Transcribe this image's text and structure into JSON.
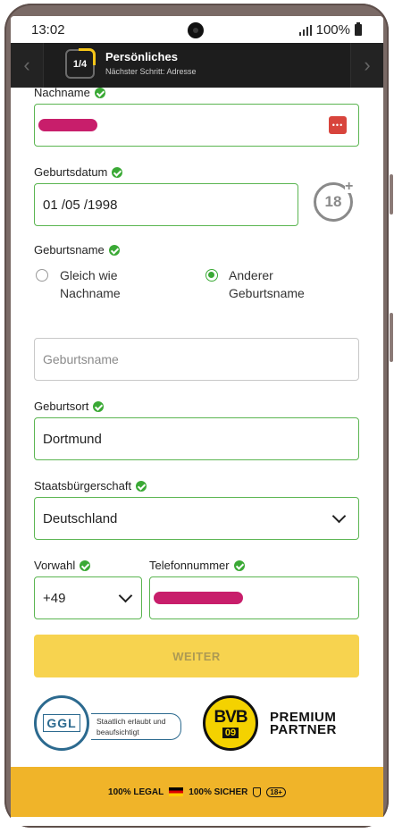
{
  "status_bar": {
    "time": "13:02",
    "battery": "100%"
  },
  "header": {
    "step": "1/4",
    "title": "Persönliches",
    "subtitle": "Nächster Schritt: Adresse",
    "prev_icon": "chevron-left-icon",
    "next_icon": "chevron-right-icon"
  },
  "form": {
    "nachname": {
      "label": "Nachname",
      "value": ""
    },
    "geburtsdatum": {
      "label": "Geburtsdatum",
      "value": "01 /05 /1998",
      "age_badge": "18"
    },
    "geburtsname": {
      "label": "Geburtsname",
      "option_same": "Gleich wie Nachname",
      "option_other": "Anderer Geburtsname",
      "selected": "Anderer Geburtsname",
      "placeholder": "Geburtsname"
    },
    "geburtsort": {
      "label": "Geburtsort",
      "value": "Dortmund"
    },
    "staatsbuergerschaft": {
      "label": "Staatsbürgerschaft",
      "value": "Deutschland"
    },
    "vorwahl": {
      "label": "Vorwahl",
      "value": "+49"
    },
    "telefon": {
      "label": "Telefonnummer",
      "value": ""
    }
  },
  "submit": {
    "label": "WEITER"
  },
  "badges": {
    "ggl_text": "Staatlich erlaubt und beaufsichtigt",
    "ggl_logo": "GGL",
    "bvb_logo_top": "BVB",
    "bvb_logo_bottom": "09",
    "premium_line1": "PREMIUM",
    "premium_line2": "PARTNER"
  },
  "footer": {
    "legal": "100% LEGAL",
    "secure": "100% SICHER",
    "age": "18+"
  },
  "colors": {
    "accent": "#f7d34f",
    "valid": "#3aa935",
    "header": "#1d1d1d",
    "footer": "#f0b429"
  }
}
